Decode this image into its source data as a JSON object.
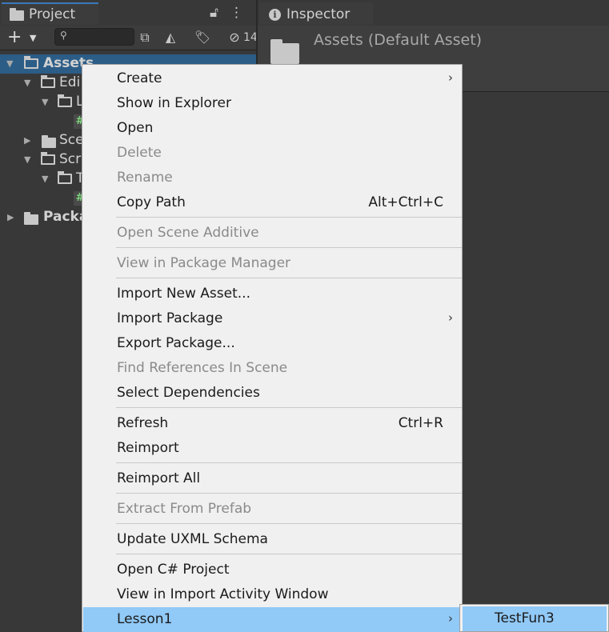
{
  "project_panel": {
    "tab_label": "Project",
    "search": {
      "value": "",
      "placeholder": ""
    },
    "hidden_count": "14",
    "tree": {
      "assets": "Assets",
      "editor": "Edi",
      "editor_child": "L",
      "scenes": "Sce",
      "scripts": "Scr",
      "scripts_child": "T",
      "packages": "Packa",
      "script_glyph": "#"
    }
  },
  "inspector": {
    "tab_label": "Inspector",
    "info_glyph": "i",
    "title": "Assets (Default Asset)"
  },
  "context_menu": {
    "items": [
      {
        "label": "Create",
        "shortcut": "",
        "submenu": true,
        "enabled": true
      },
      {
        "label": "Show in Explorer",
        "shortcut": "",
        "enabled": true
      },
      {
        "label": "Open",
        "shortcut": "",
        "enabled": true
      },
      {
        "label": "Delete",
        "shortcut": "",
        "enabled": false
      },
      {
        "label": "Rename",
        "shortcut": "",
        "enabled": false
      },
      {
        "label": "Copy Path",
        "shortcut": "Alt+Ctrl+C",
        "enabled": true
      },
      {
        "label": "Open Scene Additive",
        "shortcut": "",
        "enabled": false
      },
      {
        "label": "View in Package Manager",
        "shortcut": "",
        "enabled": false
      },
      {
        "label": "Import New Asset...",
        "shortcut": "",
        "enabled": true
      },
      {
        "label": "Import Package",
        "shortcut": "",
        "submenu": true,
        "enabled": true
      },
      {
        "label": "Export Package...",
        "shortcut": "",
        "enabled": true
      },
      {
        "label": "Find References In Scene",
        "shortcut": "",
        "enabled": false
      },
      {
        "label": "Select Dependencies",
        "shortcut": "",
        "enabled": true
      },
      {
        "label": "Refresh",
        "shortcut": "Ctrl+R",
        "enabled": true
      },
      {
        "label": "Reimport",
        "shortcut": "",
        "enabled": true
      },
      {
        "label": "Reimport All",
        "shortcut": "",
        "enabled": true
      },
      {
        "label": "Extract From Prefab",
        "shortcut": "",
        "enabled": false
      },
      {
        "label": "Update UXML Schema",
        "shortcut": "",
        "enabled": true
      },
      {
        "label": "Open C# Project",
        "shortcut": "",
        "enabled": true
      },
      {
        "label": "View in Import Activity Window",
        "shortcut": "",
        "enabled": true
      },
      {
        "label": "Lesson1",
        "shortcut": "",
        "submenu": true,
        "enabled": true,
        "highlighted": true
      }
    ],
    "submenu_arrow": "›",
    "submenu": {
      "items": [
        {
          "label": "TestFun3",
          "highlighted": true
        }
      ]
    }
  },
  "colors": {
    "selection": "#2c5d87",
    "menu_highlight": "#91c9f7",
    "menu_background": "#f0f0f0",
    "panel_background": "#383838",
    "disabled_text": "#8a8a8a"
  }
}
